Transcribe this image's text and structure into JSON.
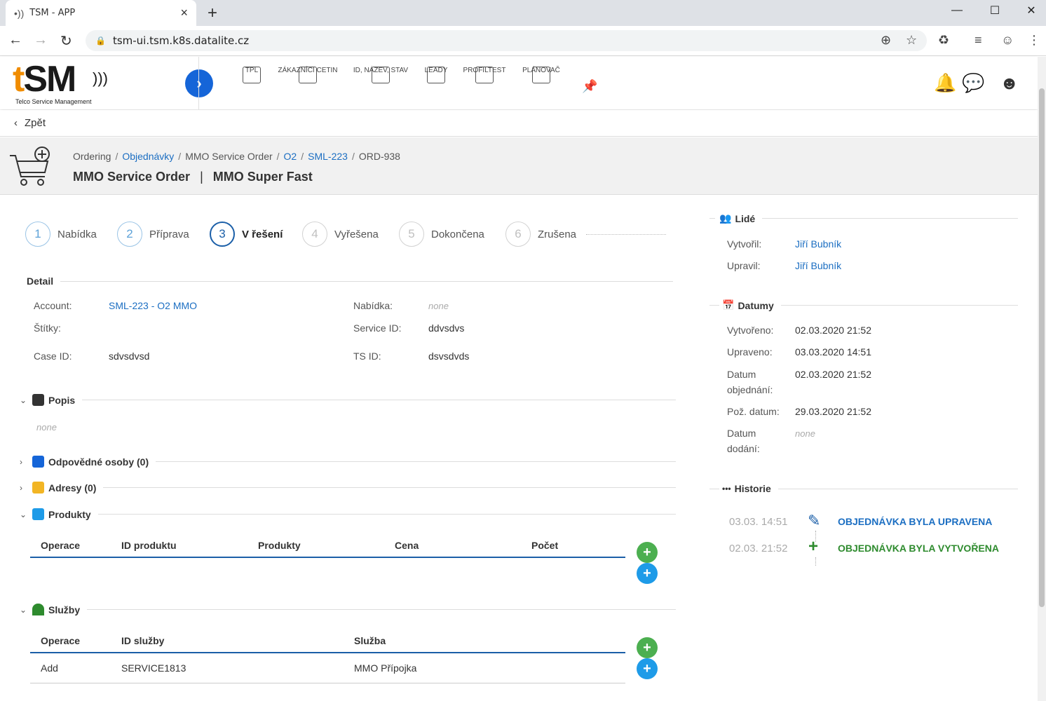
{
  "browser": {
    "tab_title": "TSM - APP",
    "url": "tsm-ui.tsm.k8s.datalite.cz",
    "new_tab_icon": "+",
    "close_icon": "×"
  },
  "app": {
    "logo_t": "t",
    "logo_sm": "SM",
    "logo_sub": "Telco Service Management",
    "nav": [
      "TPL",
      "ZÁKAZNÍCI CETIN",
      "ID, NÁZEV, STAV",
      "LEADY",
      "PROFILTEST",
      "PLÁNOVAČ"
    ]
  },
  "back_label": "Zpět",
  "breadcrumb": {
    "ordering": "Ordering",
    "objednavky": "Objednávky",
    "mmo_service_order": "MMO Service Order",
    "o2": "O2",
    "sml": "SML-223",
    "ord": "ORD-938",
    "sep": "/"
  },
  "title": {
    "main": "MMO Service Order",
    "divider": "|",
    "sub": "MMO Super Fast"
  },
  "steps": [
    {
      "num": "1",
      "label": "Nabídka"
    },
    {
      "num": "2",
      "label": "Příprava"
    },
    {
      "num": "3",
      "label": "V řešení"
    },
    {
      "num": "4",
      "label": "Vyřešena"
    },
    {
      "num": "5",
      "label": "Dokončena"
    },
    {
      "num": "6",
      "label": "Zrušena"
    }
  ],
  "detail": {
    "title": "Detail",
    "account_label": "Account:",
    "account_value": "SML-223 - O2 MMO",
    "stitky_label": "Štítky:",
    "case_label": "Case ID:",
    "case_value": "sdvsdvsd",
    "nabidka_label": "Nabídka:",
    "nabidka_value": "none",
    "service_label": "Service ID:",
    "service_value": "ddvsdvs",
    "ts_label": "TS ID:",
    "ts_value": "dsvsdvds"
  },
  "popis": {
    "title": "Popis",
    "value": "none"
  },
  "odpovedne": {
    "title": "Odpovědné osoby (0)"
  },
  "adresy": {
    "title": "Adresy (0)"
  },
  "produkty": {
    "title": "Produkty",
    "headers": [
      "Operace",
      "ID produktu",
      "Produkty",
      "Cena",
      "Počet"
    ]
  },
  "sluzby": {
    "title": "Služby",
    "headers": [
      "Operace",
      "ID služby",
      "Služba"
    ],
    "rows": [
      [
        "Add",
        "SERVICE1813",
        "MMO Přípojka"
      ]
    ]
  },
  "lide": {
    "title": "Lidé",
    "vytvoril_label": "Vytvořil:",
    "vytvoril_value": "Jiří Bubník",
    "upravil_label": "Upravil:",
    "upravil_value": "Jiří Bubník"
  },
  "datumy": {
    "title": "Datumy",
    "vytvoreno_label": "Vytvořeno:",
    "vytvoreno_value": "02.03.2020 21:52",
    "upraveno_label": "Upraveno:",
    "upraveno_value": "03.03.2020 14:51",
    "objednani_label_1": "Datum",
    "objednani_label_2": "objednání:",
    "objednani_value": "02.03.2020 21:52",
    "poz_label": "Pož. datum:",
    "poz_value": "29.03.2020 21:52",
    "dodani_label_1": "Datum",
    "dodani_label_2": "dodání:",
    "dodani_value": "none"
  },
  "historie": {
    "title": "Historie",
    "items": [
      {
        "date": "03.03. 14:51",
        "text": "OBJEDNÁVKA BYLA UPRAVENA"
      },
      {
        "date": "02.03. 21:52",
        "text": "OBJEDNÁVKA BYLA VYTVOŘENA"
      }
    ]
  },
  "colors": {
    "primary": "#1565d8",
    "link": "#1b6ec2",
    "green": "#4caf50",
    "accent_blue": "#1e9be8",
    "logo_orange": "#f08c00"
  }
}
